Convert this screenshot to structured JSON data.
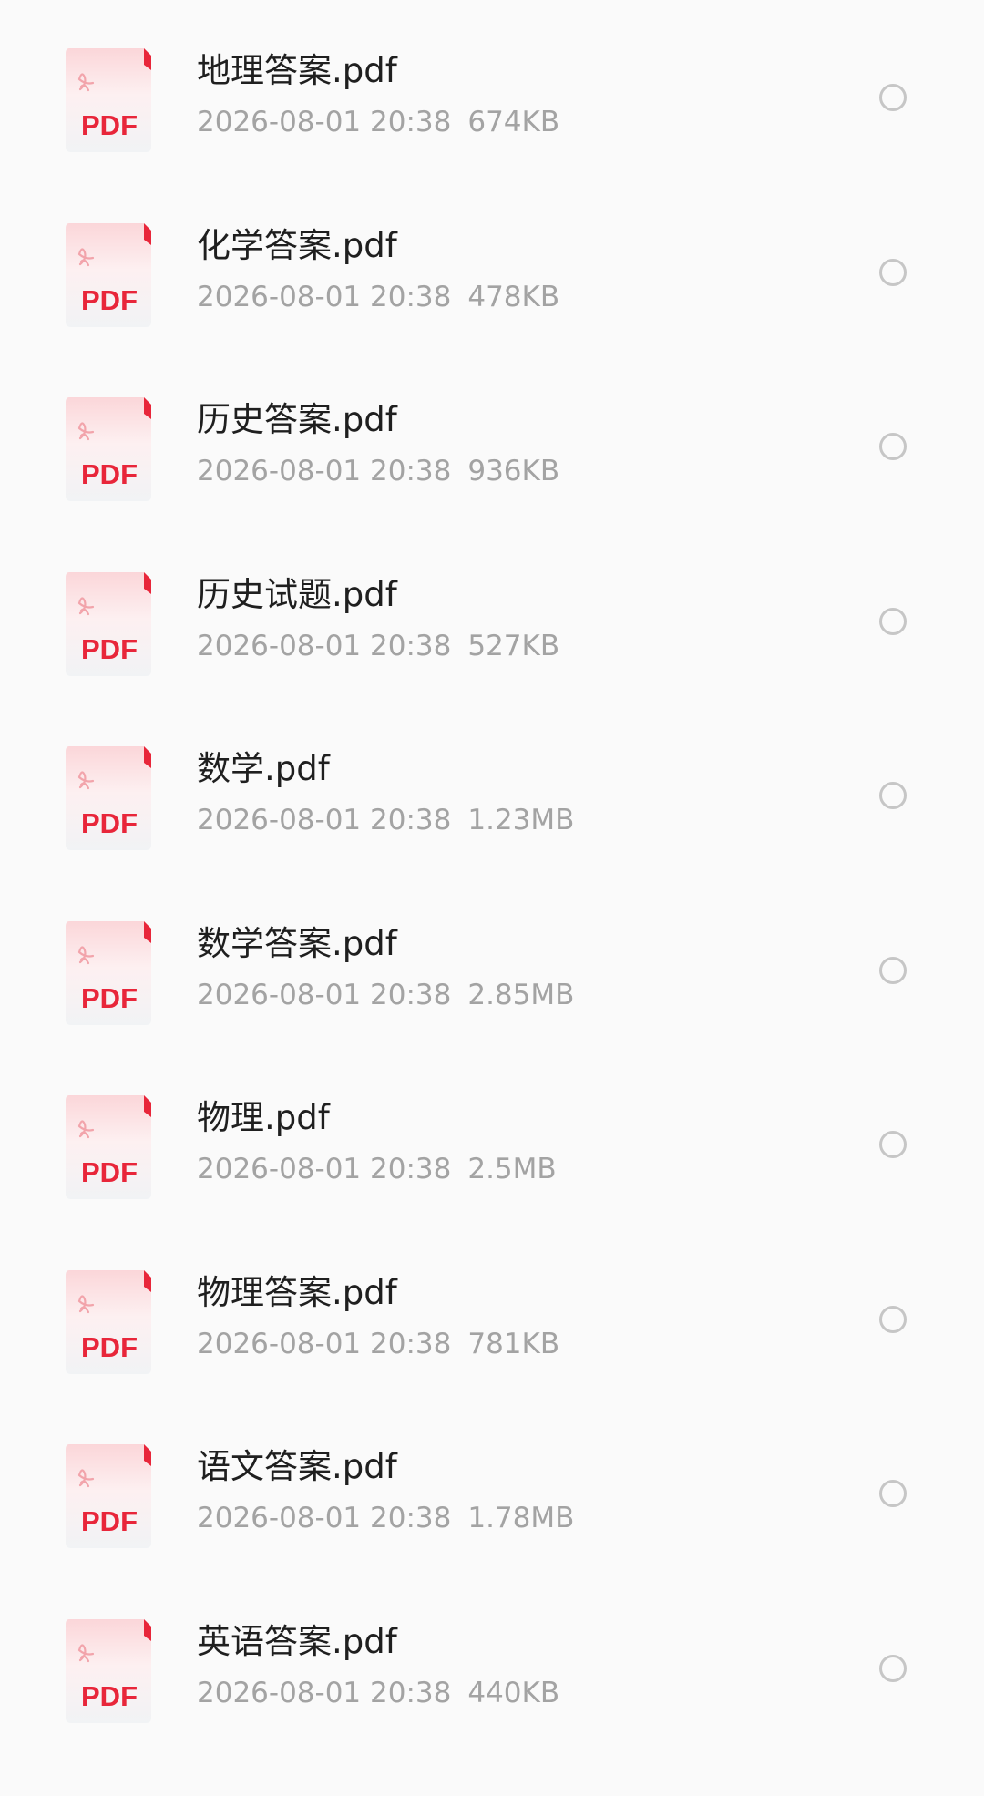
{
  "files": [
    {
      "name": "地理答案.pdf",
      "date": "2026-08-01 20:38",
      "size": "674KB",
      "icon_label": "PDF"
    },
    {
      "name": "化学答案.pdf",
      "date": "2026-08-01 20:38",
      "size": "478KB",
      "icon_label": "PDF"
    },
    {
      "name": "历史答案.pdf",
      "date": "2026-08-01 20:38",
      "size": "936KB",
      "icon_label": "PDF"
    },
    {
      "name": "历史试题.pdf",
      "date": "2026-08-01 20:38",
      "size": "527KB",
      "icon_label": "PDF"
    },
    {
      "name": "数学.pdf",
      "date": "2026-08-01 20:38",
      "size": "1.23MB",
      "icon_label": "PDF"
    },
    {
      "name": "数学答案.pdf",
      "date": "2026-08-01 20:38",
      "size": "2.85MB",
      "icon_label": "PDF"
    },
    {
      "name": "物理.pdf",
      "date": "2026-08-01 20:38",
      "size": "2.5MB",
      "icon_label": "PDF"
    },
    {
      "name": "物理答案.pdf",
      "date": "2026-08-01 20:38",
      "size": "781KB",
      "icon_label": "PDF"
    },
    {
      "name": "语文答案.pdf",
      "date": "2026-08-01 20:38",
      "size": "1.78MB",
      "icon_label": "PDF"
    },
    {
      "name": "英语答案.pdf",
      "date": "2026-08-01 20:38",
      "size": "440KB",
      "icon_label": "PDF"
    }
  ],
  "icons": {
    "file": "pdf-file-icon",
    "select": "radio-unchecked-icon"
  },
  "colors": {
    "pdf_red": "#e8263a",
    "name_text": "#1f1f1f",
    "meta_text": "#a3a3a3",
    "background": "#fafafa",
    "radio_border": "#c6c6c6"
  }
}
